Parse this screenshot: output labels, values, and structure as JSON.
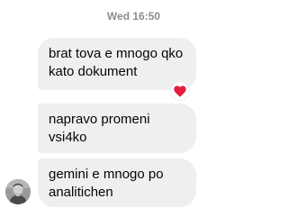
{
  "chat": {
    "timestamp": "Wed 16:50",
    "messages": [
      {
        "text": "brat tova e mnogo qko\nkato dokument",
        "reaction": "heart-icon"
      },
      {
        "text": "napravo promeni\nvsi4ko"
      },
      {
        "text": "gemini e mnogo po\nanalitichen"
      }
    ],
    "reaction_color": "#e41e3f",
    "bubble_color": "#efeff1"
  }
}
